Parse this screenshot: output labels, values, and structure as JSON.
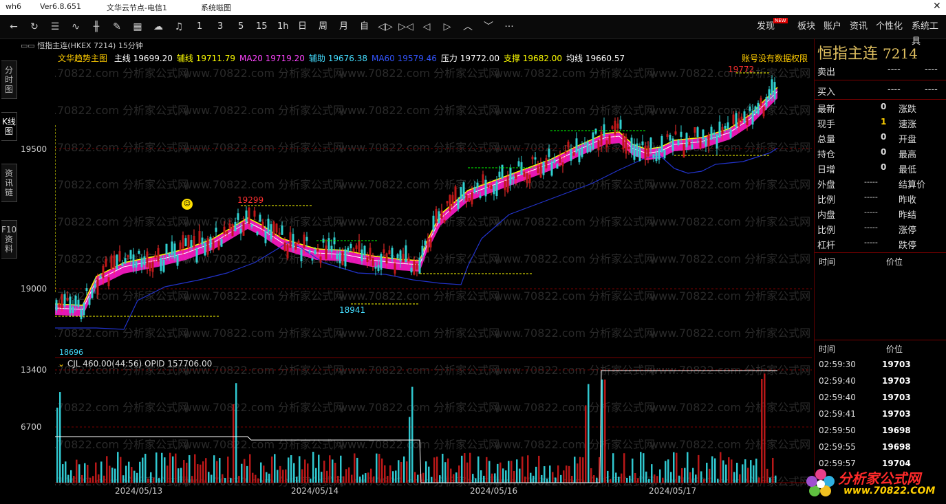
{
  "app": {
    "name": "wh6",
    "version": "Ver6.8.651",
    "node": "文华云节点-电信1",
    "system": "系统嗞图"
  },
  "toolbar": {
    "periods": [
      "1",
      "3",
      "5",
      "15",
      "1h",
      "日",
      "周",
      "月",
      "自"
    ],
    "right_items": [
      "发现",
      "板块",
      "账户",
      "资讯",
      "个性化",
      "系统工具"
    ],
    "new_badge": "NEW"
  },
  "side_tabs": [
    "分时图",
    "K线图",
    "资讯链",
    "F10资料"
  ],
  "chart": {
    "symbol_line": "恒指主连(HKEX 7214)  15分钟",
    "indicator_name": "文华趋势主图",
    "legend": [
      {
        "label": "主线",
        "value": "19699.20",
        "color": "#ffffff"
      },
      {
        "label": "辅线",
        "value": "19711.79",
        "color": "#ffff00"
      },
      {
        "label": "MA20",
        "value": "19719.20",
        "color": "#ff44ff"
      },
      {
        "label": "辅助",
        "value": "19676.38",
        "color": "#44ddff"
      },
      {
        "label": "MA60",
        "value": "19579.46",
        "color": "#3355ff"
      },
      {
        "label": "压力",
        "value": "19772.00",
        "color": "#ffffff"
      },
      {
        "label": "支撑",
        "value": "19682.00",
        "color": "#ffff00"
      },
      {
        "label": "均线",
        "value": "19660.57",
        "color": "#ffffff"
      }
    ],
    "no_permission": "账号没有数据权限",
    "price_ticks": [
      "19500",
      "19000"
    ],
    "annotations": {
      "high": "19772",
      "peak": "19299",
      "low": "18941",
      "left_low": "18696"
    },
    "volume_legend": "CJL  460.00(44:56)  OPID 157706.00",
    "volume_ticks": [
      "13400",
      "6700"
    ],
    "dates": [
      "2024/05/13",
      "2024/05/14",
      "2024/05/16",
      "2024/05/17"
    ],
    "watermark": "www.70822.com 分析家公式网"
  },
  "quote": {
    "title": "恒指主连",
    "code": "7214",
    "sell": "卖出",
    "buy": "买入",
    "dash": "----",
    "rows": [
      {
        "l": "最新",
        "v": "0",
        "r": "涨跌"
      },
      {
        "l": "现手",
        "v": "1",
        "r": "速涨"
      },
      {
        "l": "总量",
        "v": "0",
        "r": "开盘"
      },
      {
        "l": "持仓",
        "v": "0",
        "r": "最高"
      },
      {
        "l": "日增",
        "v": "0",
        "r": "最低"
      },
      {
        "l": "外盘",
        "v": "-----",
        "r": "结算价"
      },
      {
        "l": "比例",
        "v": "-----",
        "r": "昨收"
      },
      {
        "l": "内盘",
        "v": "-----",
        "r": "昨结"
      },
      {
        "l": "比例",
        "v": "-----",
        "r": "涨停"
      },
      {
        "l": "杠杆",
        "v": "-----",
        "r": "跌停"
      }
    ],
    "time_hdr": "时间",
    "price_hdr": "价位",
    "ticks": [
      {
        "t": "02:59:30",
        "p": "19703"
      },
      {
        "t": "02:59:40",
        "p": "19703"
      },
      {
        "t": "02:59:40",
        "p": "19703"
      },
      {
        "t": "02:59:41",
        "p": "19703"
      },
      {
        "t": "02:59:50",
        "p": "19698"
      },
      {
        "t": "02:59:55",
        "p": "19698"
      },
      {
        "t": "02:59:57",
        "p": "19704"
      }
    ]
  },
  "logo": {
    "text": "分析家公式网",
    "url": "www.70822.COM"
  }
}
